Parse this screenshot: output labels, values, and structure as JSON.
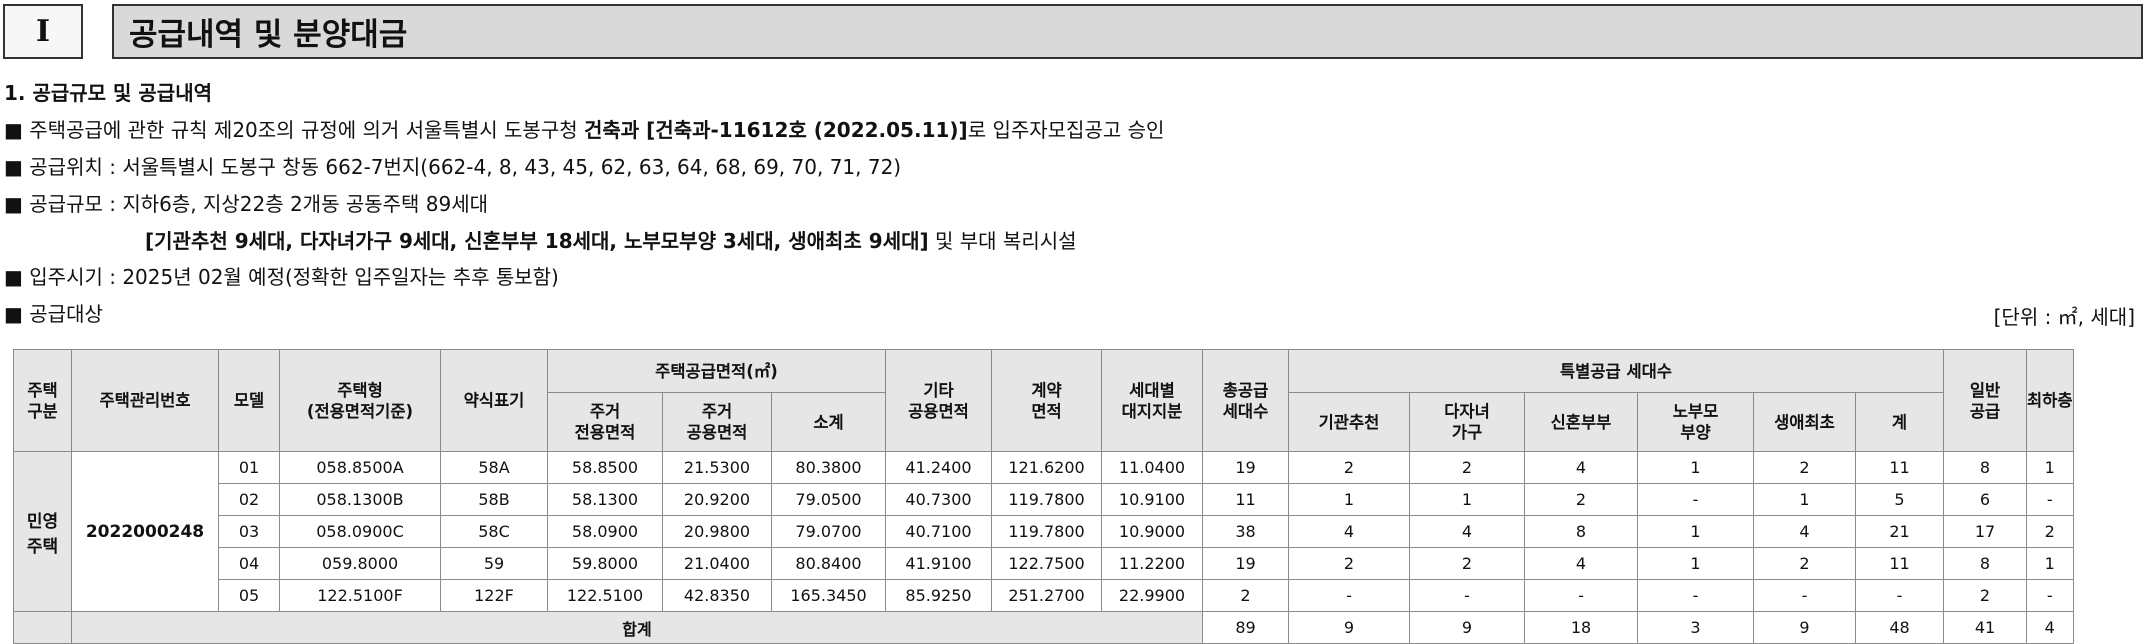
{
  "header": {
    "number": "I",
    "title": "공급내역 및 분양대금"
  },
  "section_title": "1. 공급규모 및 공급내역",
  "lines": {
    "approval": {
      "bullet": "■",
      "pre": " 주택공급에 관한 규칙 제20조의 규정에 의거 서울특별시 도봉구청 ",
      "bold": "건축과 [건축과-11612호 (2022.05.11)]",
      "post": "로 입주자모집공고 승인"
    },
    "location": {
      "bullet": "■",
      "text": " 공급위치 : 서울특별시 도봉구 창동 662-7번지(662-4, 8, 43, 45, 62, 63, 64, 68, 69, 70, 71, 72)"
    },
    "scale": {
      "bullet": "■",
      "text": " 공급규모 : 지하6층, 지상22층 2개동 공동주택 89세대"
    },
    "scale2": {
      "bold": "[기관추천 9세대, 다자녀가구 9세대, 신혼부부 18세대, 노부모부양 3세대, 생애최초 9세대]",
      "post": " 및 부대 복리시설"
    },
    "movein": {
      "bullet": "■",
      "text": " 입주시기 : 2025년 02월 예정(정확한 입주일자는 추후 통보함)"
    },
    "target": {
      "bullet": "■",
      "text": " 공급대상"
    }
  },
  "unit_note": "[단위 : ㎡, 세대]",
  "table": {
    "headers": {
      "type": "주택\n구분",
      "mgmt_no": "주택관리번호",
      "model": "모델",
      "house_type": "주택형\n(전용면적기준)",
      "abbrev": "약식표기",
      "supply_area": "주택공급면적(㎡)",
      "exclusive": "주거\n전용면적",
      "common": "주거\n공용면적",
      "subtotal": "소계",
      "other_common": "기타\n공용면적",
      "contract_area": "계약\n면적",
      "land_share": "세대별\n대지지분",
      "total_units": "총공급\n세대수",
      "special": "특별공급 세대수",
      "institution": "기관추천",
      "multichild": "다자녀\n가구",
      "newlywed": "신혼부부",
      "elderly": "노부모\n부양",
      "firsttime": "생애최초",
      "special_total": "계",
      "general": "일반\n공급",
      "lowest": "최하층"
    },
    "house_category": "민영\n주택",
    "mgmt_number": "2022000248",
    "rows": [
      {
        "model": "01",
        "type": "058.8500A",
        "abbrev": "58A",
        "exclusive": "58.8500",
        "common": "21.5300",
        "subtotal": "80.3800",
        "other": "41.2400",
        "contract": "121.6200",
        "land": "11.0400",
        "total": "19",
        "institution": "2",
        "multichild": "2",
        "newlywed": "4",
        "elderly": "1",
        "firsttime": "2",
        "sp_total": "11",
        "general": "8",
        "lowest": "1"
      },
      {
        "model": "02",
        "type": "058.1300B",
        "abbrev": "58B",
        "exclusive": "58.1300",
        "common": "20.9200",
        "subtotal": "79.0500",
        "other": "40.7300",
        "contract": "119.7800",
        "land": "10.9100",
        "total": "11",
        "institution": "1",
        "multichild": "1",
        "newlywed": "2",
        "elderly": "-",
        "firsttime": "1",
        "sp_total": "5",
        "general": "6",
        "lowest": "-"
      },
      {
        "model": "03",
        "type": "058.0900C",
        "abbrev": "58C",
        "exclusive": "58.0900",
        "common": "20.9800",
        "subtotal": "79.0700",
        "other": "40.7100",
        "contract": "119.7800",
        "land": "10.9000",
        "total": "38",
        "institution": "4",
        "multichild": "4",
        "newlywed": "8",
        "elderly": "1",
        "firsttime": "4",
        "sp_total": "21",
        "general": "17",
        "lowest": "2"
      },
      {
        "model": "04",
        "type": "059.8000",
        "abbrev": "59",
        "exclusive": "59.8000",
        "common": "21.0400",
        "subtotal": "80.8400",
        "other": "41.9100",
        "contract": "122.7500",
        "land": "11.2200",
        "total": "19",
        "institution": "2",
        "multichild": "2",
        "newlywed": "4",
        "elderly": "1",
        "firsttime": "2",
        "sp_total": "11",
        "general": "8",
        "lowest": "1"
      },
      {
        "model": "05",
        "type": "122.5100F",
        "abbrev": "122F",
        "exclusive": "122.5100",
        "common": "42.8350",
        "subtotal": "165.3450",
        "other": "85.9250",
        "contract": "251.2700",
        "land": "22.9900",
        "total": "2",
        "institution": "-",
        "multichild": "-",
        "newlywed": "-",
        "elderly": "-",
        "firsttime": "-",
        "sp_total": "-",
        "general": "2",
        "lowest": "-"
      }
    ],
    "totals": {
      "label": "합계",
      "total": "89",
      "institution": "9",
      "multichild": "9",
      "newlywed": "18",
      "elderly": "3",
      "firsttime": "9",
      "sp_total": "48",
      "general": "41",
      "lowest": "4"
    }
  }
}
